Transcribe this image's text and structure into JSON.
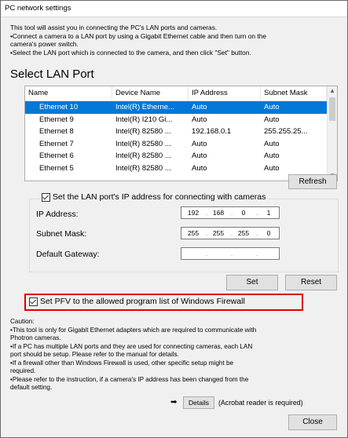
{
  "window": {
    "title": "PC network settings"
  },
  "intro": {
    "lines": [
      "This tool will assist you in connecting the PC's LAN ports and cameras.",
      "•Connect a camera to a LAN port by using a Gigabit Ethernet cable and then turn on the",
      "camera's power switch.",
      "•Select the LAN port which is connected to the camera, and then click \"Set\" button."
    ]
  },
  "lan": {
    "title": "Select LAN Port",
    "columns": [
      "Name",
      "Device Name",
      "IP Address",
      "Subnet Mask"
    ],
    "rows": [
      {
        "name": "Ethernet 10",
        "device": "Intel(R) Etherne...",
        "ip": "Auto",
        "mask": "Auto"
      },
      {
        "name": "Ethernet 9",
        "device": "Intel(R) I210 Gi...",
        "ip": "Auto",
        "mask": "Auto"
      },
      {
        "name": "Ethernet 8",
        "device": "Intel(R) 82580 ...",
        "ip": "192.168.0.1",
        "mask": "255.255.25..."
      },
      {
        "name": "Ethernet 7",
        "device": "Intel(R) 82580 ...",
        "ip": "Auto",
        "mask": "Auto"
      },
      {
        "name": "Ethernet 6",
        "device": "Intel(R) 82580 ...",
        "ip": "Auto",
        "mask": "Auto"
      },
      {
        "name": "Ethernet 5",
        "device": "Intel(R) 82580 ...",
        "ip": "Auto",
        "mask": "Auto"
      }
    ],
    "selected_index": 0,
    "refresh_label": "Refresh"
  },
  "ipgroup": {
    "legend": "Set the LAN port's IP address for connecting with cameras",
    "ip_label": "IP Address:",
    "mask_label": "Subnet Mask:",
    "gateway_label": "Default Gateway:",
    "ip": [
      "192",
      "168",
      "0",
      "1"
    ],
    "mask": [
      "255",
      "255",
      "255",
      "0"
    ],
    "gateway": [
      "",
      "",
      "",
      ""
    ],
    "set_label": "Set",
    "reset_label": "Reset"
  },
  "firewall": {
    "label": "Set PFV to the allowed program list of Windows Firewall",
    "checked": true,
    "highlight_color": "#e00000"
  },
  "caution": {
    "lines": [
      "Caution:",
      "•This tool is only for Gigabit Ethernet adapters which are required to communicate with",
      "Photron cameras.",
      "•If a PC has multiple LAN ports and they are used for connecting cameras, each LAN",
      "port should be setup. Please refer to the manual for details.",
      "•If a firewall other than Windows Firewall is used, other specific setup might be",
      "required.",
      "•Please refer to the instruction, if a camera's IP address has been changed from the",
      "default setting."
    ]
  },
  "details": {
    "arrow": "➡",
    "button_label": "Details",
    "note": "(Acrobat reader is required)"
  },
  "close_label": "Close",
  "colors": {
    "selection": "#0078d7",
    "window_bg": "#f0f0f0"
  }
}
